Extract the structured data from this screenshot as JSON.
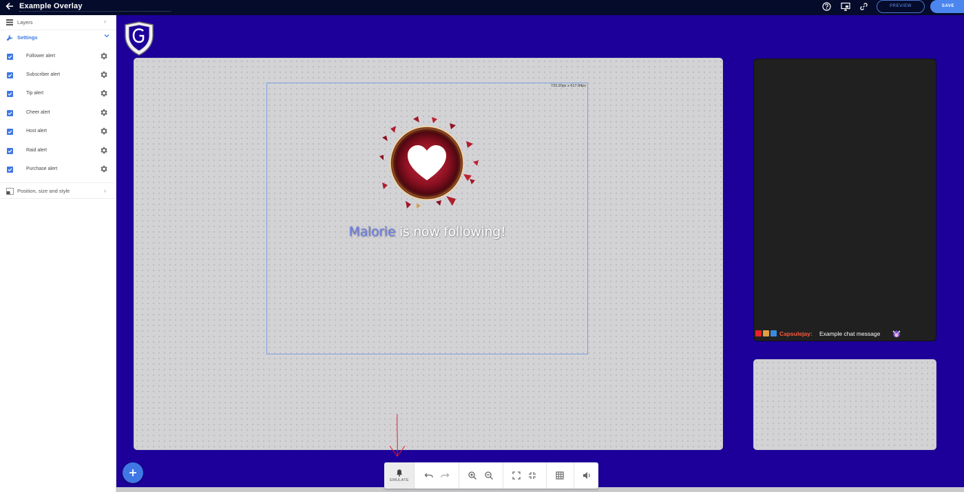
{
  "topbar": {
    "title": "Example Overlay",
    "preview_label": "PREVIEW",
    "save_label": "SAVE"
  },
  "panel": {
    "layers_label": "Layers",
    "settings_label": "Settings",
    "alerts": [
      {
        "label": "Follower alert",
        "checked": true
      },
      {
        "label": "Subscriber alert",
        "checked": true
      },
      {
        "label": "Tip alert",
        "checked": true
      },
      {
        "label": "Cheer alert",
        "checked": true
      },
      {
        "label": "Host alert",
        "checked": true
      },
      {
        "label": "Raid alert",
        "checked": true
      },
      {
        "label": "Purchase alert",
        "checked": true
      }
    ],
    "position_label": "Position, size and style"
  },
  "canvas": {
    "selection_size": "733.20px x 617.84px",
    "alert_name": "Malorie",
    "alert_message": " is now following!"
  },
  "chat": {
    "username": "Capsulejay:",
    "message": "Example chat message"
  },
  "toolbar": {
    "emulate_label": "EMULATE"
  },
  "colors": {
    "background": "#1c0099",
    "accent": "#3f78e4",
    "alert_name": "#6d7fe8",
    "chat_username": "#ff5a3a"
  }
}
